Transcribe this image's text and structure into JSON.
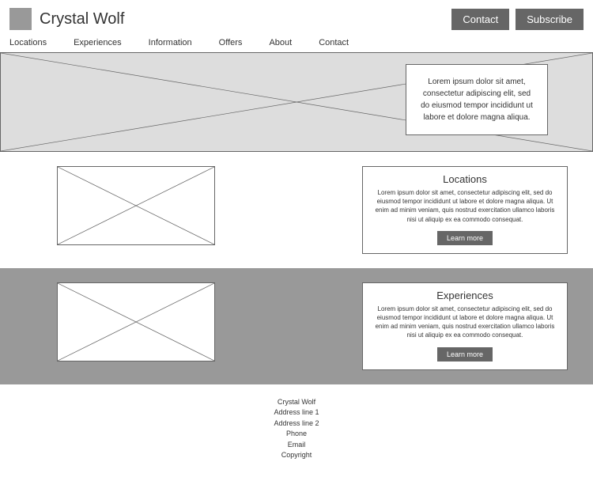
{
  "header": {
    "brand": "Crystal Wolf",
    "contact_btn": "Contact",
    "subscribe_btn": "Subscribe"
  },
  "nav": {
    "items": [
      "Locations",
      "Experiences",
      "Information",
      "Offers",
      "About",
      "Contact"
    ]
  },
  "hero": {
    "card_text": "Lorem ipsum dolor sit amet, consectetur adipiscing elit, sed do eiusmod tempor incididunt ut labore et dolore magna aliqua."
  },
  "sections": [
    {
      "title": "Locations",
      "body": "Lorem ipsum dolor sit amet, consectetur adipiscing elit, sed do eiusmod tempor incididunt ut labore et dolore magna aliqua. Ut enim ad minim veniam, quis nostrud exercitation ullamco laboris nisi ut aliquip ex ea commodo consequat.",
      "cta": "Learn more"
    },
    {
      "title": "Experiences",
      "body": "Lorem ipsum dolor sit amet, consectetur adipiscing elit, sed do eiusmod tempor incididunt ut labore et dolore magna aliqua. Ut enim ad minim veniam, quis nostrud exercitation ullamco laboris nisi ut aliquip ex ea commodo consequat.",
      "cta": "Learn more"
    }
  ],
  "footer": {
    "lines": [
      "Crystal Wolf",
      "Address line 1",
      "Address line 2",
      "Phone",
      "Email",
      "Copyright"
    ]
  }
}
